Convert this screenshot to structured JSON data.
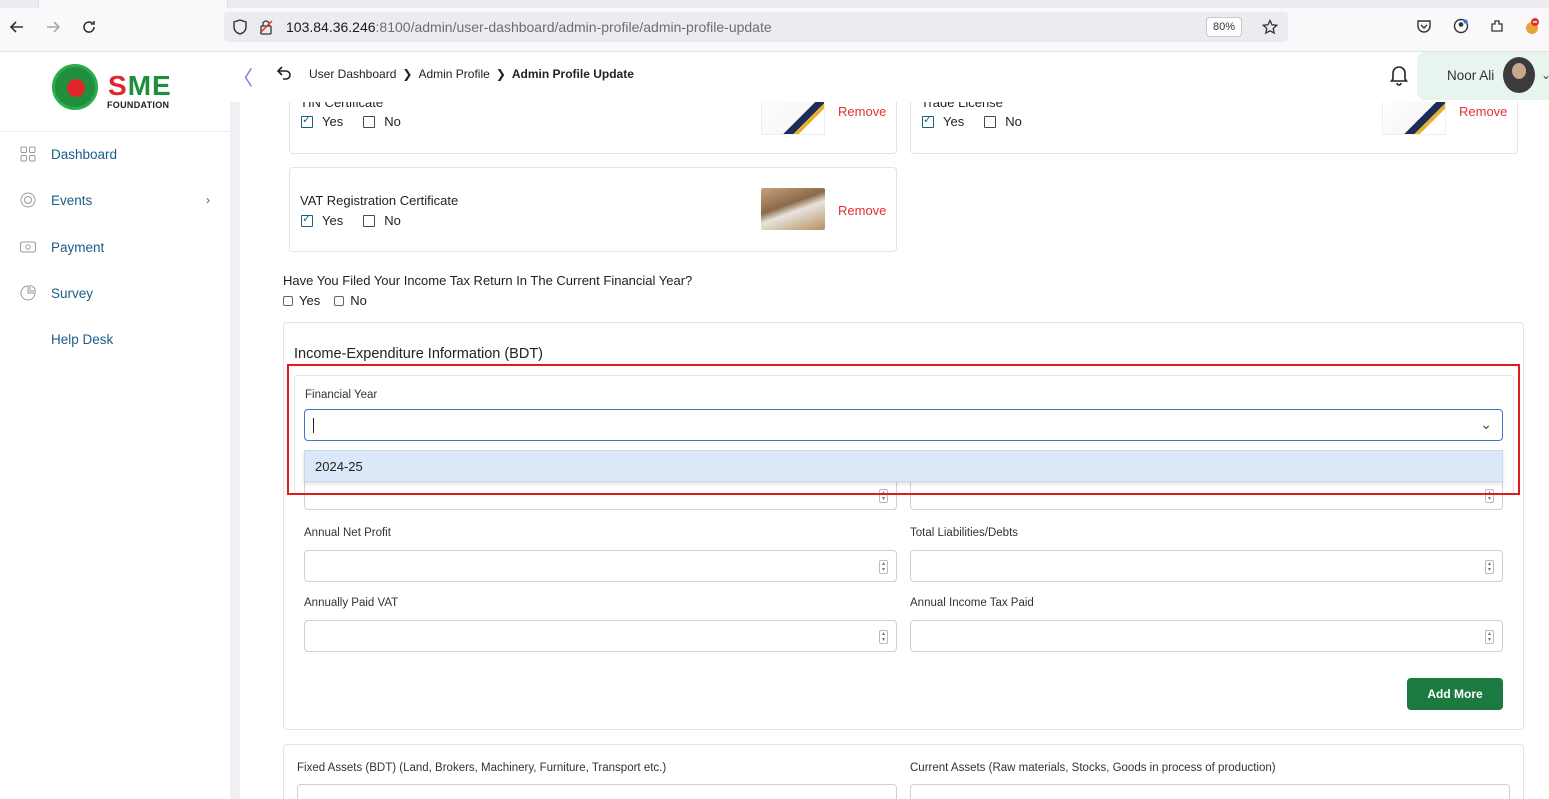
{
  "browser": {
    "url_host": "103.84.36.246",
    "url_path": ":8100/admin/user-dashboard/admin-profile/admin-profile-update",
    "zoom": "80%"
  },
  "brand": {
    "logo_text_left": "S",
    "logo_text_right": "ME",
    "logo_sub": "FOUNDATION",
    "accent_color": "#1c7a40",
    "remove_color": "#e0332f",
    "highlight_color": "#e01b1b"
  },
  "breadcrumb": {
    "items": [
      "User Dashboard",
      "Admin Profile",
      "Admin Profile Update"
    ]
  },
  "user": {
    "name": "Noor Ali"
  },
  "sidebar": {
    "items": [
      {
        "label": "Dashboard",
        "icon": "grid-icon"
      },
      {
        "label": "Events",
        "icon": "events-icon"
      },
      {
        "label": "Payment",
        "icon": "payment-icon"
      },
      {
        "label": "Survey",
        "icon": "pie-chart-icon"
      },
      {
        "label": "Help Desk",
        "icon": ""
      }
    ]
  },
  "documents": [
    {
      "title": "TIN Certificate",
      "yes": "Yes",
      "no": "No",
      "yes_checked": true,
      "remove": "Remove"
    },
    {
      "title": "Trade License",
      "yes": "Yes",
      "no": "No",
      "yes_checked": true,
      "remove": "Remove"
    },
    {
      "title": "VAT Registration Certificate",
      "yes": "Yes",
      "no": "No",
      "yes_checked": true,
      "remove": "Remove"
    }
  ],
  "tax_question": {
    "text": "Have You Filed Your Income Tax Return In The Current Financial Year?",
    "yes": "Yes",
    "no": "No"
  },
  "income_expenditure": {
    "title": "Income-Expenditure Information (BDT)",
    "financial_year_label": "Financial Year",
    "financial_year_value": "",
    "dropdown_options": [
      "2024-25"
    ],
    "fields": {
      "annual_net_profit": "Annual Net Profit",
      "total_liabilities": "Total Liabilities/Debts",
      "annually_paid_vat": "Annually Paid VAT",
      "annual_income_tax": "Annual Income Tax Paid"
    },
    "add_more": "Add More"
  },
  "assets": {
    "fixed_label": "Fixed Assets (BDT) (Land, Brokers, Machinery, Furniture, Transport etc.)",
    "current_label": "Current Assets (Raw materials, Stocks, Goods in process of production)"
  }
}
